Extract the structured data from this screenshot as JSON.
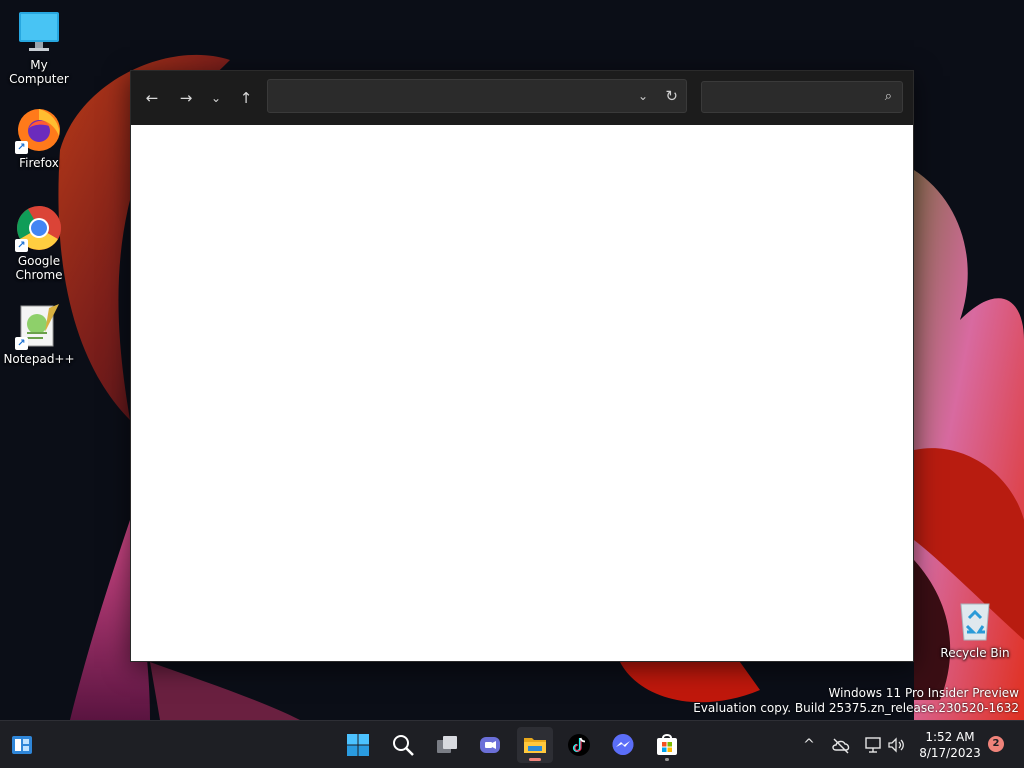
{
  "desktop": {
    "icons": [
      {
        "label": "My Computer",
        "icon": "computer-icon"
      },
      {
        "label": "Firefox",
        "icon": "firefox-icon"
      },
      {
        "label": "Google Chrome",
        "icon": "chrome-icon"
      },
      {
        "label": "Notepad++",
        "icon": "notepadpp-icon"
      },
      {
        "label": "Recycle Bin",
        "icon": "recycle-bin-icon"
      }
    ]
  },
  "explorer": {
    "nav": {
      "back": "←",
      "forward": "→",
      "recent": "⌄",
      "up": "↑"
    },
    "address": {
      "value": "",
      "dropdown": "⌄",
      "refresh": "↻"
    },
    "search": {
      "value": "",
      "icon": "⌕"
    }
  },
  "watermark": {
    "line1": "Windows 11 Pro Insider Preview",
    "line2": "Evaluation copy. Build 25375.zn_release.230520-1632"
  },
  "taskbar": {
    "apps": [
      {
        "name": "widgets",
        "icon": "widgets-icon"
      },
      {
        "name": "start",
        "icon": "windows-start-icon"
      },
      {
        "name": "search",
        "icon": "search-icon"
      },
      {
        "name": "task-view",
        "icon": "task-view-icon"
      },
      {
        "name": "teams-chat",
        "icon": "chat-icon"
      },
      {
        "name": "file-explorer",
        "icon": "folder-icon"
      },
      {
        "name": "tiktok",
        "icon": "tiktok-icon"
      },
      {
        "name": "messenger",
        "icon": "messenger-icon"
      },
      {
        "name": "store",
        "icon": "store-icon"
      }
    ],
    "tray": {
      "chevron": "^",
      "clock_time": "1:52 AM",
      "clock_date": "8/17/2023",
      "notification_count": "2"
    }
  },
  "colors": {
    "accent": "#4cc2ff",
    "window_toolbar": "#1c1c1c",
    "taskbar": "#1e1f24",
    "badge": "#f0837a"
  }
}
